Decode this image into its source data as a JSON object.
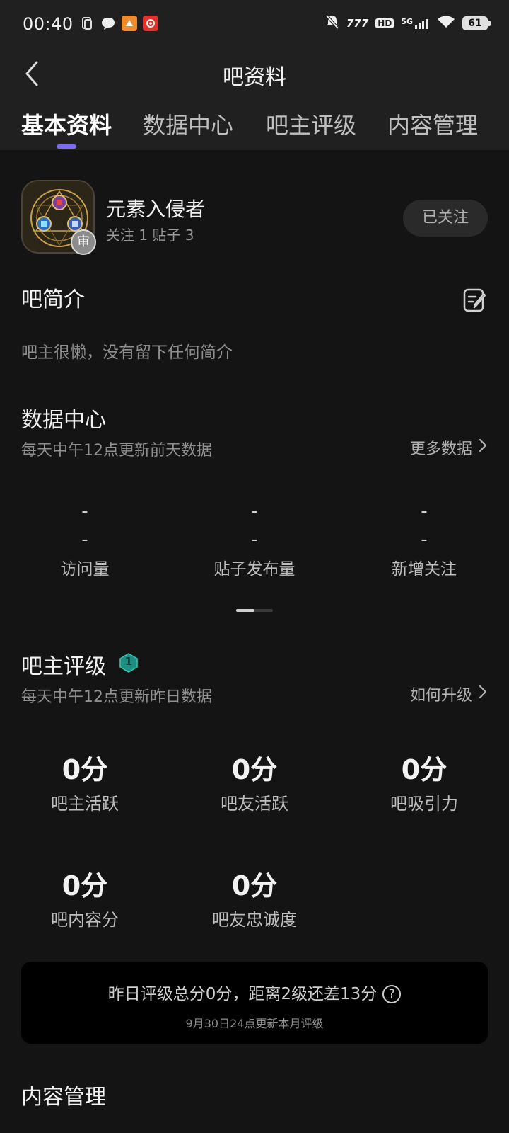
{
  "status": {
    "time": "00:40",
    "network": "5G",
    "hd": "HD",
    "speed": "777",
    "battery": "61"
  },
  "nav": {
    "title": "吧资料"
  },
  "tabs": [
    {
      "label": "基本资料",
      "active": true
    },
    {
      "label": "数据中心",
      "active": false
    },
    {
      "label": "吧主评级",
      "active": false
    },
    {
      "label": "内容管理",
      "active": false
    }
  ],
  "forum": {
    "name": "元素入侵者",
    "stats": "关注 1  贴子 3",
    "review_badge": "审",
    "follow_label": "已关注"
  },
  "intro": {
    "title": "吧简介",
    "text": "吧主很懒，没有留下任何简介"
  },
  "data_center": {
    "title": "数据中心",
    "subtitle": "每天中午12点更新前天数据",
    "more_label": "更多数据",
    "items": [
      {
        "value": "-",
        "label": "访问量"
      },
      {
        "value": "-",
        "label": "贴子发布量"
      },
      {
        "value": "-",
        "label": "新增关注"
      }
    ]
  },
  "rating": {
    "title": "吧主评级",
    "level": "1",
    "subtitle": "每天中午12点更新昨日数据",
    "upgrade_label": "如何升级",
    "scores": [
      {
        "value": "0分",
        "label": "吧主活跃"
      },
      {
        "value": "0分",
        "label": "吧友活跃"
      },
      {
        "value": "0分",
        "label": "吧吸引力"
      },
      {
        "value": "0分",
        "label": "吧内容分"
      },
      {
        "value": "0分",
        "label": "吧友忠诚度"
      }
    ],
    "summary": "昨日评级总分0分，距离2级还差13分",
    "summary_note": "9月30日24点更新本月评级",
    "help_symbol": "?"
  },
  "content_mgmt": {
    "title": "内容管理"
  },
  "colors": {
    "accent": "#7a6cf0",
    "background": "#141414",
    "header": "#202020",
    "level_badge": "#1a8f83"
  }
}
